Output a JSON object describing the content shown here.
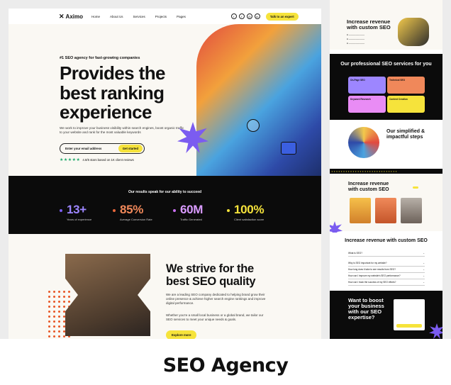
{
  "caption": "SEO Agency",
  "nav": {
    "logo": "Aximo",
    "links": [
      "Home",
      "About Us",
      "Services",
      "Projects",
      "Pages"
    ],
    "social": [
      "twitter-icon",
      "facebook-icon",
      "instagram-icon",
      "linkedin-icon"
    ],
    "cta": "Talk to an expert"
  },
  "hero": {
    "tag": "#1 SEO agency for fast-growing companies",
    "title": "Provides the best ranking experience",
    "description": "We work to improve your business visibility within search engines, boost organic traffic to your website and rank for the most valuable keywords",
    "email_placeholder": "Enter your email address",
    "cta": "Get started",
    "rating": "4.8/5 stars based on 1K client reviews"
  },
  "stats": {
    "title": "Our results speak for our ability to succeed",
    "items": [
      {
        "value": "13+",
        "label": "Years of experience",
        "color": "#7b5cf0"
      },
      {
        "value": "85%",
        "label": "Average Conversion Rate",
        "color": "#e8663a"
      },
      {
        "value": "60M",
        "label": "Traffic Generated",
        "color": "#c86ff0"
      },
      {
        "value": "100%",
        "label": "Client satisfaction score",
        "color": "#f6e33b"
      }
    ]
  },
  "strive": {
    "title": "We strive for the best SEO quality",
    "p1": "We are a leading SEO company dedicated to helping brand grow their online presence & achieve higher search engine rankings and improve digital performance.",
    "p2": "Whether you're a small local business or a global brand, we tailor our SEO services to meet your unique needs & goals.",
    "cta": "Explore more"
  },
  "side": {
    "revenue_title": "Increase revenue with custom SEO",
    "services_title": "Our professional SEO services for you",
    "services": [
      "On-Page SEO",
      "Technical SEO",
      "Keyword Research",
      "Content Creation"
    ],
    "steps_title": "Our simplified & impactful steps",
    "team_title": "Increase revenue with custom SEO",
    "faq_title": "Increase revenue with custom SEO",
    "faqs": [
      "What is SEO?",
      "Why is SEO important for my website?",
      "How long does it take to see results from SEO?",
      "How can I improve my website's SEO performance?",
      "How can I track the success of my SEO efforts?"
    ],
    "cta_title": "Want to boost your business with our SEO expertise?"
  }
}
